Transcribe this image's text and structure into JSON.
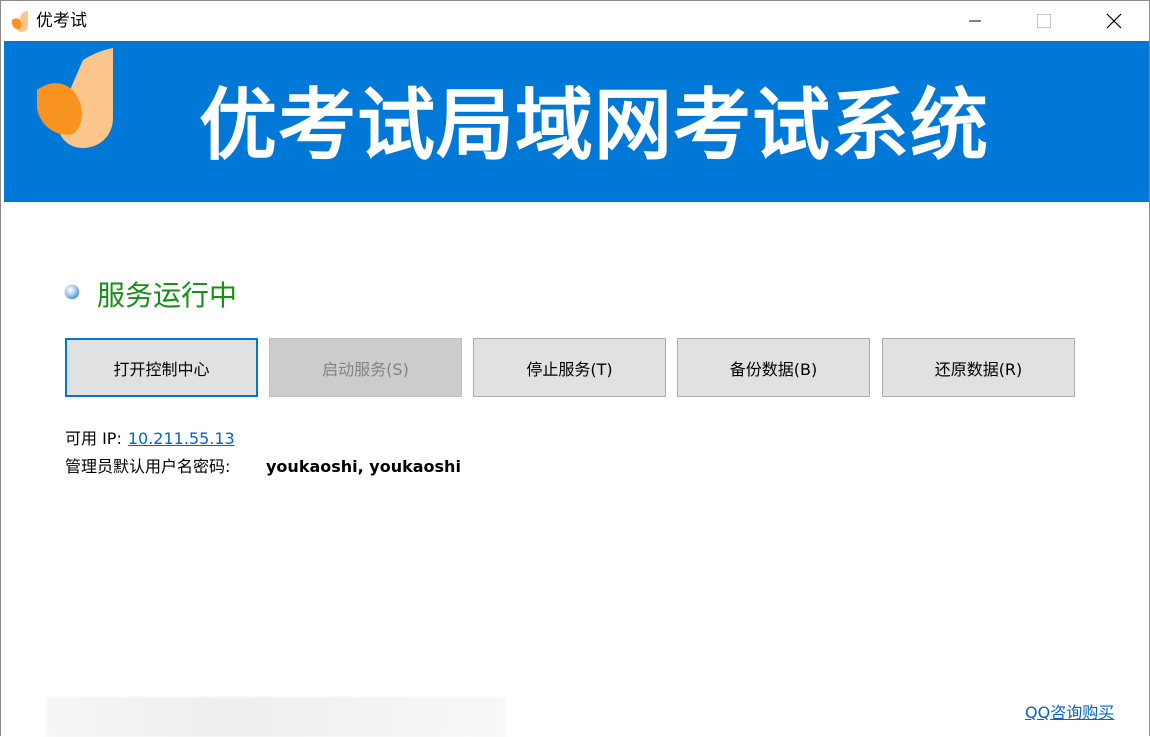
{
  "window": {
    "title": "优考试",
    "icon": "app-logo-icon",
    "controls": [
      "minimize-icon",
      "maximize-icon",
      "close-icon"
    ]
  },
  "banner": {
    "title": "优考试局域网考试系统",
    "background": "#0078d7",
    "logo": "app-logo-icon"
  },
  "status": {
    "text": "服务运行中",
    "color": "#169016",
    "indicator": "status-dot-icon"
  },
  "buttons": {
    "open_control_center": "打开控制中心",
    "start_service": "启动服务(S)",
    "stop_service": "停止服务(T)",
    "backup_data": "备份数据(B)",
    "restore_data": "还原数据(R)"
  },
  "info": {
    "ip_label": "可用 IP:",
    "ip_value": "10.211.55.13",
    "admin_label": "管理员默认用户名密码:",
    "admin_value": "youkaoshi, youkaoshi"
  },
  "footer": {
    "qq_link": "QQ咨询购买"
  },
  "colors": {
    "accent": "#0078d7",
    "link": "#0066cc",
    "logo_orange": "#f7931e",
    "logo_peach": "#fcc58a"
  }
}
